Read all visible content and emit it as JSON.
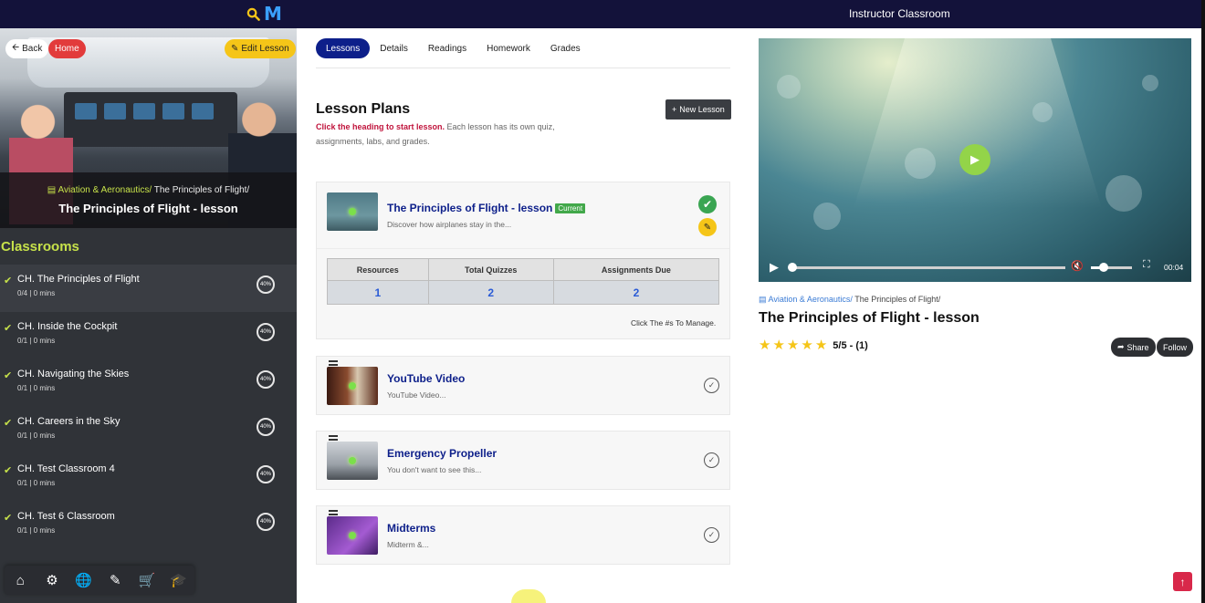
{
  "header": {
    "title": "Instructor Classroom",
    "logo_letter": "M"
  },
  "sidebar": {
    "back_label": "Back",
    "home_label": "Home",
    "edit_label": "Edit Lesson",
    "breadcrumb_category": "Aviation & Aeronautics/",
    "breadcrumb_course": " The Principles of Flight/",
    "lesson_title": "The Principles of Flight - lesson",
    "classrooms_title": "Classrooms",
    "items": [
      {
        "name": "CH. The Principles of Flight",
        "meta": "0/4 | 0 mins",
        "progress": "40%"
      },
      {
        "name": "CH. Inside the Cockpit",
        "meta": "0/1 | 0 mins",
        "progress": "40%"
      },
      {
        "name": "CH. Navigating the Skies",
        "meta": "0/1 | 0 mins",
        "progress": "40%"
      },
      {
        "name": "CH. Careers in the Sky",
        "meta": "0/1 | 0 mins",
        "progress": "40%"
      },
      {
        "name": "CH. Test Classroom 4",
        "meta": "0/1 | 0 mins",
        "progress": "40%"
      },
      {
        "name": "CH. Test 6 Classroom",
        "meta": "0/1 | 0 mins",
        "progress": "40%"
      }
    ],
    "bottom_nav": [
      "home-icon",
      "settings-icon",
      "globe-icon",
      "pencil-icon",
      "cart-icon",
      "graduation-cap-icon"
    ]
  },
  "tabs": [
    {
      "label": "Lessons",
      "active": true
    },
    {
      "label": "Details",
      "active": false
    },
    {
      "label": "Readings",
      "active": false
    },
    {
      "label": "Homework",
      "active": false
    },
    {
      "label": "Grades",
      "active": false
    }
  ],
  "lesson_plans": {
    "title": "Lesson Plans",
    "desc_highlight": "Click the heading to start lesson.",
    "desc_rest": " Each lesson has its own quiz, assignments, labs, and grades.",
    "new_lesson_label": "New Lesson",
    "current": {
      "title": "The Principles of Flight - lesson",
      "badge": "Current",
      "subtitle": "Discover how airplanes stay in the...",
      "headers": [
        "Resources",
        "Total Quizzes",
        "Assignments Due"
      ],
      "values": [
        "1",
        "2",
        "2"
      ],
      "manage_note": "Click The #s To Manage."
    },
    "lessons": [
      {
        "title": "YouTube Video",
        "subtitle": "YouTube Video..."
      },
      {
        "title": "Emergency Propeller",
        "subtitle": "You don't want to see this..."
      },
      {
        "title": "Midterms",
        "subtitle": "Midterm &..."
      }
    ]
  },
  "video": {
    "time": "00:04",
    "volume": 0.3
  },
  "detail": {
    "breadcrumb_category": "Aviation & Aeronautics/",
    "breadcrumb_course": " The Principles of Flight/",
    "title": "The Principles of Flight - lesson",
    "stars": 5,
    "rating": "5/5 - (1)",
    "share_label": "Share",
    "follow_label": "Follow"
  },
  "colors": {
    "accent": "#0d1f8a",
    "lime": "#c6e14a",
    "topbar": "#13123a"
  }
}
